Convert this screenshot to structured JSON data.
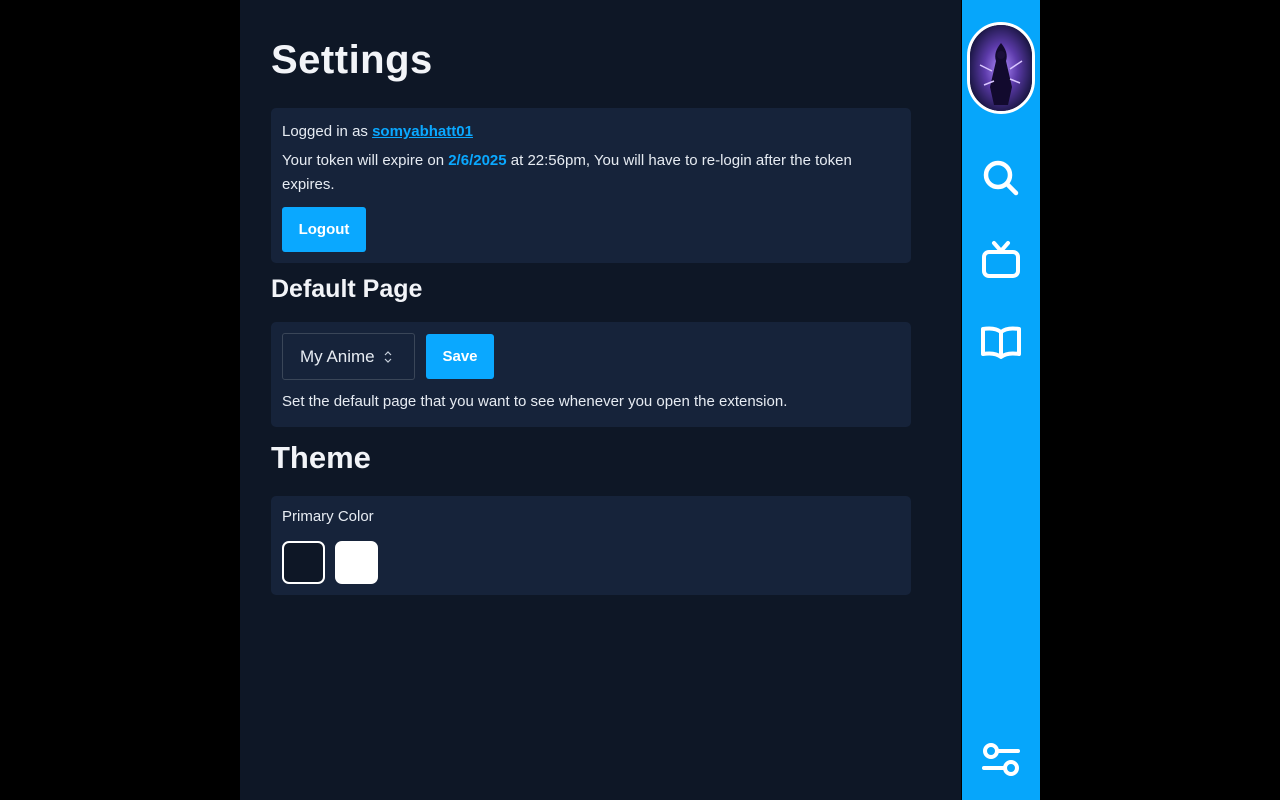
{
  "page": {
    "title": "Settings"
  },
  "account": {
    "logged_in_prefix": "Logged in as ",
    "username": "somyabhatt01",
    "token_prefix": "Your token will expire on ",
    "token_date": "2/6/2025",
    "token_suffix": " at 22:56pm, You will have to re-login after the token expires.",
    "logout_label": "Logout"
  },
  "default_page": {
    "heading": "Default Page",
    "selected": "My Anime",
    "save_label": "Save",
    "help": "Set the default page that you want to see whenever you open the extension."
  },
  "theme": {
    "heading": "Theme",
    "primary_color_label": "Primary Color",
    "swatches": [
      "#0e1726",
      "#ffffff"
    ]
  },
  "sidebar": {
    "icons": [
      "avatar",
      "search-icon",
      "tv-icon",
      "book-icon",
      "settings-sliders-icon"
    ],
    "accent_color": "#06a6fb"
  },
  "colors": {
    "background": "#0e1726",
    "card": "#16233a",
    "accent": "#0aa8ff"
  }
}
